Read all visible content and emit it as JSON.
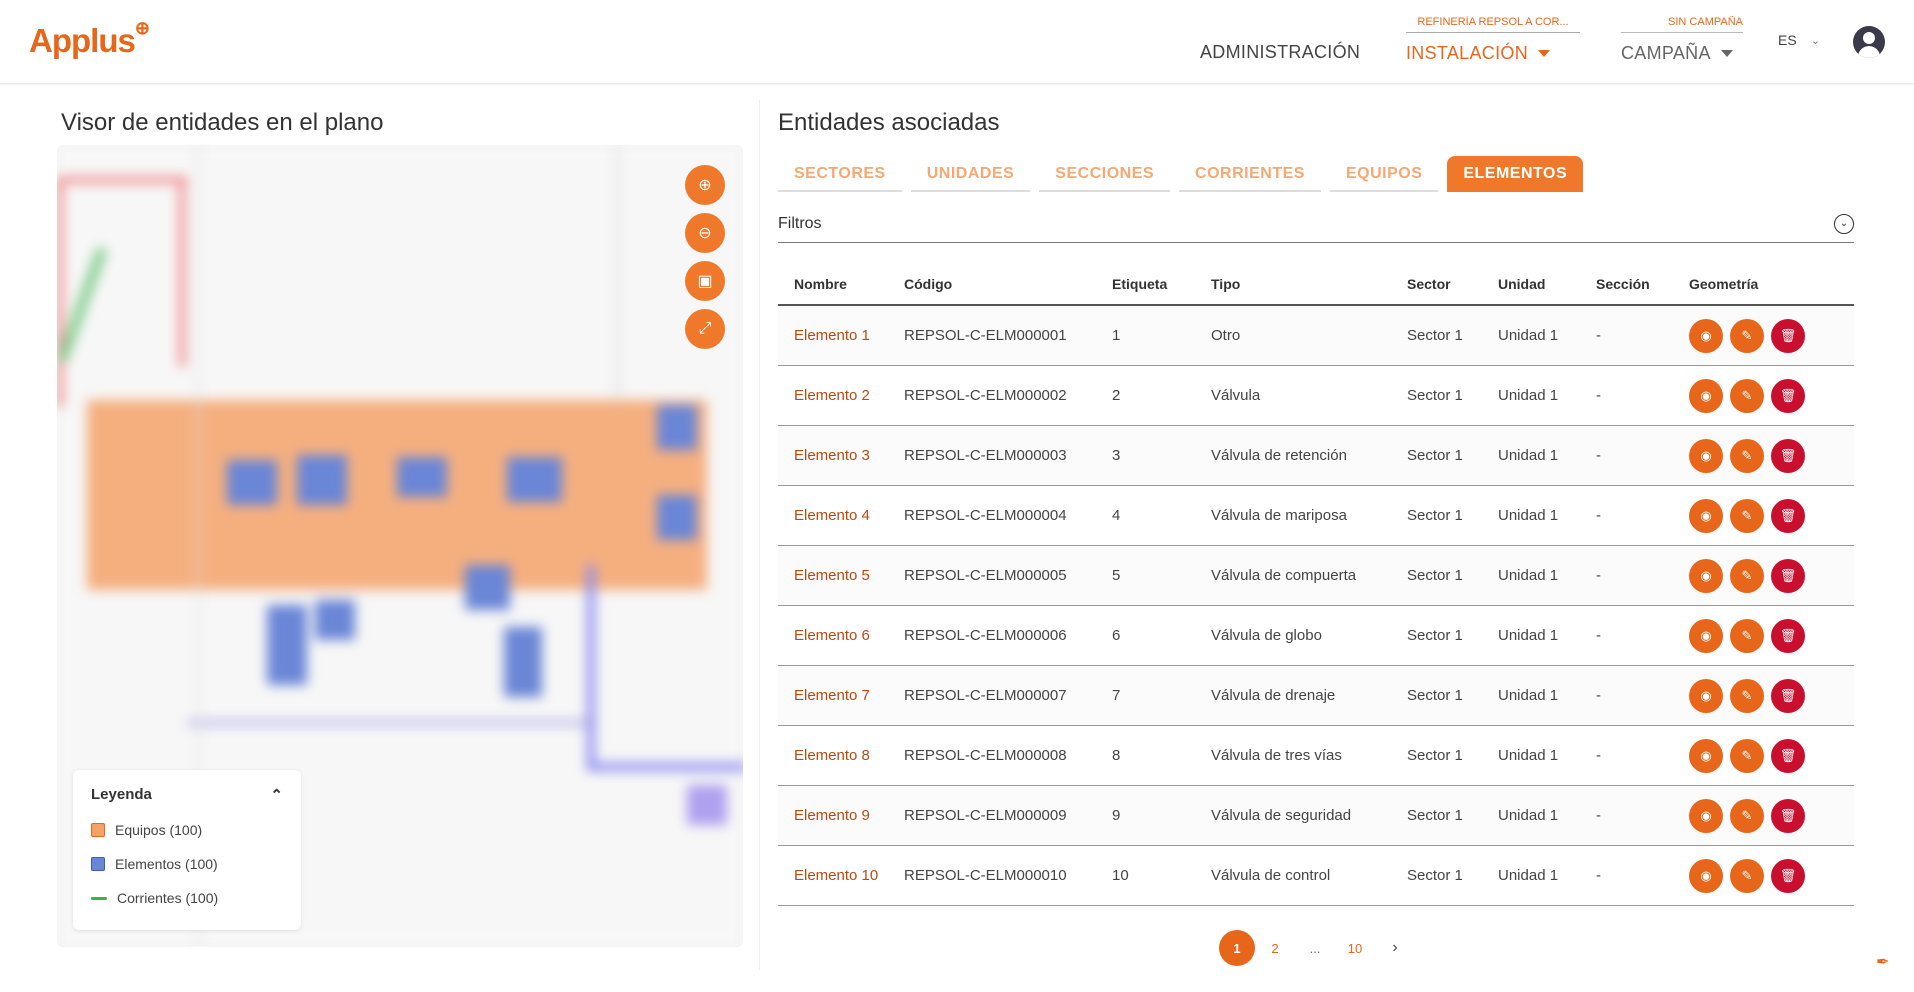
{
  "header": {
    "logo_text": "Applus",
    "logo_plus": "⊕",
    "nav_admin": "ADMINISTRACIÓN",
    "installation_context": "REFINERÍA REPSOL A COR...",
    "installation_label": "INSTALACIÓN",
    "campaign_context": "SIN CAMPAÑA",
    "campaign_label": "CAMPAÑA",
    "language": "ES"
  },
  "viewer": {
    "title": "Visor de entidades en el plano",
    "legend": {
      "title": "Leyenda",
      "items": [
        {
          "label": "Equipos (100)",
          "color": "#f0a070"
        },
        {
          "label": "Elementos (100)",
          "color": "#5b7fd6"
        },
        {
          "label": "Corrientes (100)",
          "color": "#3bb24a"
        }
      ]
    }
  },
  "entities": {
    "title": "Entidades asociadas",
    "tabs": [
      "SECTORES",
      "UNIDADES",
      "SECCIONES",
      "CORRIENTES",
      "EQUIPOS",
      "ELEMENTOS"
    ],
    "active_tab": "ELEMENTOS",
    "filters_label": "Filtros",
    "columns": [
      "Nombre",
      "Código",
      "Etiqueta",
      "Tipo",
      "Sector",
      "Unidad",
      "Sección",
      "Geometría"
    ],
    "rows": [
      [
        "Elemento 1",
        "REPSOL-C-ELM000001",
        "1",
        "Otro",
        "Sector 1",
        "Unidad 1",
        "-"
      ],
      [
        "Elemento 2",
        "REPSOL-C-ELM000002",
        "2",
        "Válvula",
        "Sector 1",
        "Unidad 1",
        "-"
      ],
      [
        "Elemento 3",
        "REPSOL-C-ELM000003",
        "3",
        "Válvula de retención",
        "Sector 1",
        "Unidad 1",
        "-"
      ],
      [
        "Elemento 4",
        "REPSOL-C-ELM000004",
        "4",
        "Válvula de mariposa",
        "Sector 1",
        "Unidad 1",
        "-"
      ],
      [
        "Elemento 5",
        "REPSOL-C-ELM000005",
        "5",
        "Válvula de compuerta",
        "Sector 1",
        "Unidad 1",
        "-"
      ],
      [
        "Elemento 6",
        "REPSOL-C-ELM000006",
        "6",
        "Válvula de globo",
        "Sector 1",
        "Unidad 1",
        "-"
      ],
      [
        "Elemento 7",
        "REPSOL-C-ELM000007",
        "7",
        "Válvula de drenaje",
        "Sector 1",
        "Unidad 1",
        "-"
      ],
      [
        "Elemento 8",
        "REPSOL-C-ELM000008",
        "8",
        "Válvula de tres vías",
        "Sector 1",
        "Unidad 1",
        "-"
      ],
      [
        "Elemento 9",
        "REPSOL-C-ELM000009",
        "9",
        "Válvula de seguridad",
        "Sector 1",
        "Unidad 1",
        "-"
      ],
      [
        "Elemento 10",
        "REPSOL-C-ELM000010",
        "10",
        "Válvula de control",
        "Sector 1",
        "Unidad 1",
        "-"
      ]
    ],
    "pagination": {
      "pages": [
        "1",
        "2",
        "...",
        "10"
      ],
      "current": "1"
    }
  },
  "colors": {
    "accent": "#e8661a",
    "danger": "#c8102e"
  }
}
